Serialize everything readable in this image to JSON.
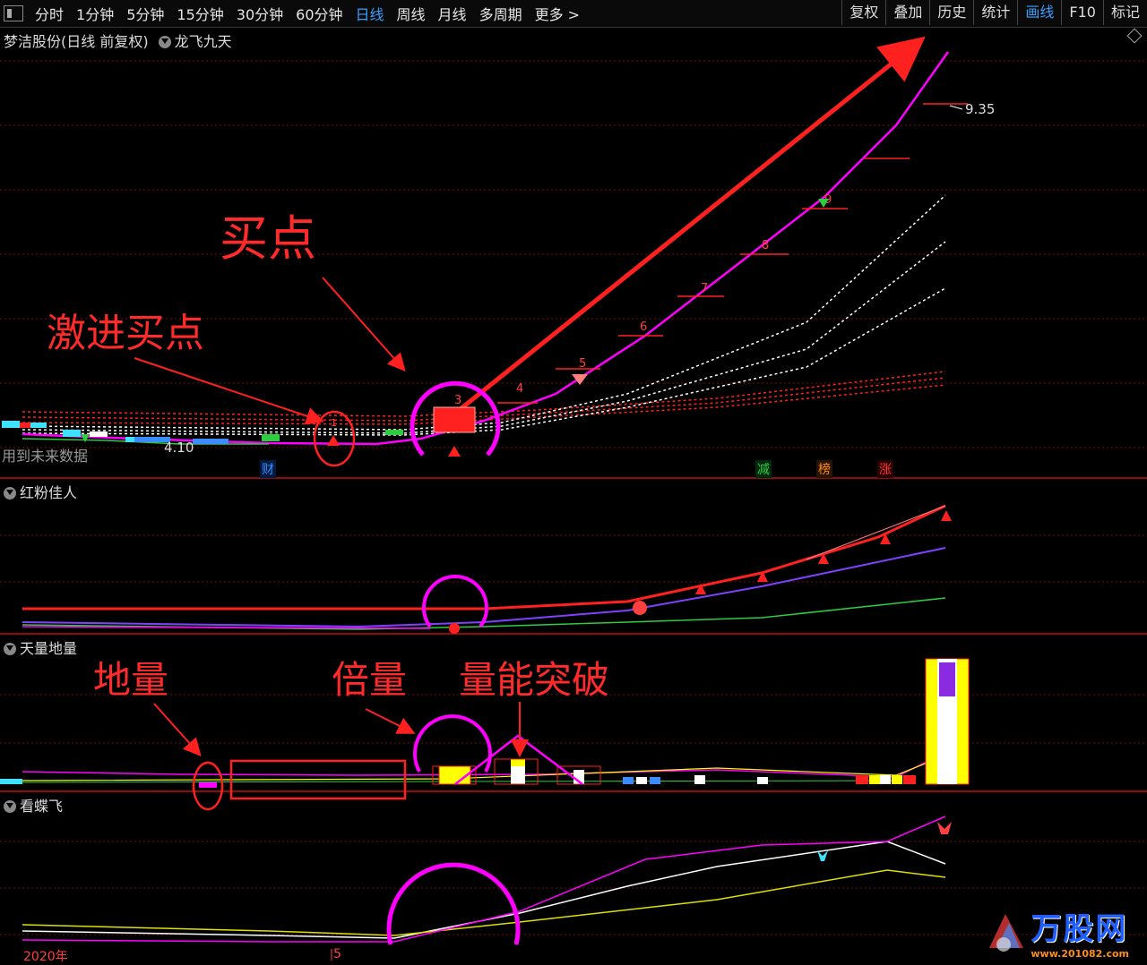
{
  "toolbar": {
    "periods": [
      "分时",
      "1分钟",
      "5分钟",
      "15分钟",
      "30分钟",
      "60分钟",
      "日线",
      "周线",
      "月线",
      "多周期",
      "更多 >"
    ],
    "active_period": "日线",
    "right_buttons": [
      "复权",
      "叠加",
      "历史",
      "统计",
      "画线",
      "F10",
      "标记"
    ],
    "active_button": "画线"
  },
  "main_panel": {
    "title": "梦洁股份(日线 前复权)",
    "indicator": "龙飞九天",
    "price_high": "9.35",
    "price_low": "4.10",
    "future_data_note": "用到未来数据",
    "wave_numbers": [
      "1",
      "3",
      "4",
      "5",
      "6",
      "7",
      "8",
      "9"
    ],
    "tags": [
      {
        "text": "财",
        "color": "#3a8cff"
      },
      {
        "text": "减",
        "color": "#2ecc40"
      },
      {
        "text": "榜",
        "color": "#ff8c1a"
      },
      {
        "text": "涨",
        "color": "#ff3333"
      }
    ]
  },
  "panel2": {
    "title": "红粉佳人"
  },
  "panel3": {
    "title": "天量地量"
  },
  "panel4": {
    "title": "看蝶飞"
  },
  "annotations": {
    "buy_point": "买点",
    "aggressive_buy": "激进买点",
    "ground_volume": "地量",
    "double_volume": "倍量",
    "volume_breakout": "量能突破"
  },
  "axis": {
    "year_label": "2020年",
    "month_label": "5"
  },
  "watermark": {
    "brand": "万股网",
    "url": "www.201082.com"
  },
  "colors": {
    "accent_blue": "#3aa0ff",
    "magenta": "#ff00ff",
    "red": "#ff2020",
    "yellow": "#ffff00"
  }
}
